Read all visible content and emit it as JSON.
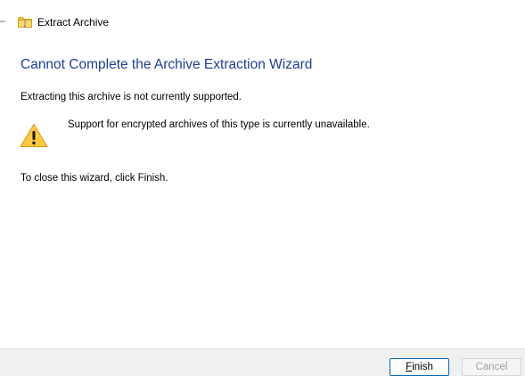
{
  "window": {
    "title": "Extract Archive",
    "icon": "zip-folder-icon"
  },
  "content": {
    "heading": "Cannot Complete the Archive Extraction Wizard",
    "message": "Extracting this archive is not currently supported.",
    "warning_icon": "warning-icon",
    "warning_text": "Support for encrypted archives of this type is currently unavailable.",
    "close_hint": "To close this wizard, click Finish."
  },
  "buttons": {
    "finish_first": "F",
    "finish_rest": "inish",
    "cancel": "Cancel"
  },
  "colors": {
    "heading": "#1e3f96",
    "focus_border": "#0067c0",
    "footer_bg": "#f0f0f0",
    "warning_fill": "#ffc83d"
  }
}
